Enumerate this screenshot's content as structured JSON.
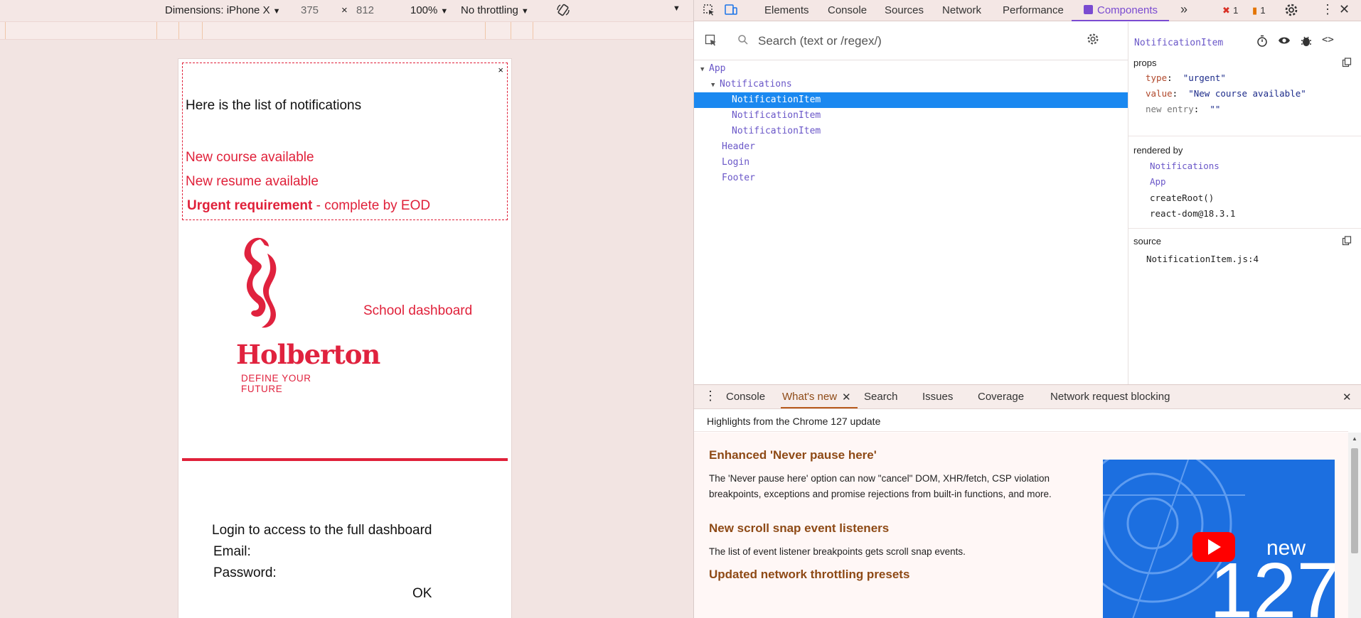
{
  "device_toolbar": {
    "dimensions_label": "Dimensions: iPhone X",
    "width": "375",
    "times": "×",
    "height": "812",
    "zoom": "100%",
    "throttling": "No throttling"
  },
  "app": {
    "notifications": {
      "close": "×",
      "title": "Here is the list of notifications",
      "items": [
        "New course available",
        "New resume available"
      ],
      "urgent_bold": "Urgent requirement",
      "urgent_rest": " - complete by EOD"
    },
    "header": {
      "logo_word": "Holberton",
      "logo_tagline": "DEFINE YOUR FUTURE",
      "title": "School dashboard"
    },
    "login": {
      "text": "Login to access to the full dashboard",
      "email_label": "Email:",
      "password_label": "Password:",
      "ok_label": "OK"
    }
  },
  "devtools": {
    "tabs": [
      "Elements",
      "Console",
      "Sources",
      "Network",
      "Performance",
      "Components"
    ],
    "active_tab": "Components",
    "more_tabs": "»",
    "error_count": "1",
    "warning_count": "1",
    "search_placeholder": "Search (text or /regex/)",
    "tree": [
      {
        "label": "App",
        "arrow": "▼"
      },
      {
        "label": "Notifications",
        "arrow": "▼"
      },
      {
        "label": "NotificationItem",
        "arrow": ""
      },
      {
        "label": "NotificationItem",
        "arrow": ""
      },
      {
        "label": "NotificationItem",
        "arrow": ""
      },
      {
        "label": "Header",
        "arrow": ""
      },
      {
        "label": "Login",
        "arrow": ""
      },
      {
        "label": "Footer",
        "arrow": ""
      }
    ],
    "inspector": {
      "component_name": "NotificationItem",
      "props_title": "props",
      "props": [
        {
          "key": "type",
          "value": "\"urgent\""
        },
        {
          "key": "value",
          "value": "\"New course available\""
        },
        {
          "key": "new entry",
          "value": "\"\""
        }
      ],
      "rendered_by_title": "rendered by",
      "rendered_by": [
        "Notifications",
        "App",
        "createRoot()",
        "react-dom@18.3.1"
      ],
      "source_title": "source",
      "source_file": "NotificationItem.js:4"
    },
    "drawer": {
      "tabs": [
        "Console",
        "What's new",
        "Search",
        "Issues",
        "Coverage",
        "Network request blocking"
      ],
      "active_tab": "What's new",
      "highlights": "Highlights from the Chrome 127 update",
      "sections": [
        {
          "title": "Enhanced 'Never pause here'",
          "body": "The 'Never pause here' option can now \"cancel\" DOM, XHR/fetch, CSP violation breakpoints, exceptions and promise rejections from built-in functions, and more."
        },
        {
          "title": "New scroll snap event listeners",
          "body": "The list of event listener breakpoints gets scroll snap events."
        },
        {
          "title": "Updated network throttling presets",
          "body": ""
        }
      ],
      "promo_new": "new",
      "promo_version": "127"
    }
  },
  "colors": {
    "holberton_red": "#e0213a",
    "react_purple": "#6a57c8",
    "selection_blue": "#1a88f0",
    "whatsnew_heading": "#8e4a16"
  }
}
